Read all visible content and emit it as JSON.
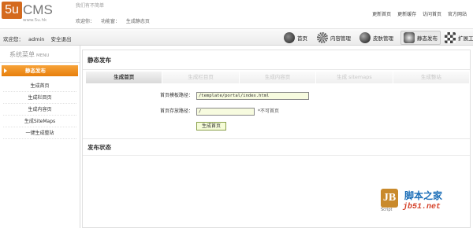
{
  "header": {
    "logo_mark": "5u",
    "logo_text": "CMS",
    "logo_sub": "www.5u.hk",
    "slogan": "我们有不简单",
    "crumbs": [
      "欢迎你：",
      "功能窗：",
      "生成静态页"
    ],
    "top_links": [
      "更新首页",
      "更新缓存",
      "访问首页",
      "官方网站"
    ]
  },
  "userbar": {
    "welcome_label": "欢迎您：",
    "username": "admin",
    "logout": "安全退出",
    "nav": [
      {
        "label": "首页",
        "icon": "home-icon",
        "color": "#3a3a3a"
      },
      {
        "label": "内容管理",
        "icon": "content-icon",
        "color": "#5a5a5a"
      },
      {
        "label": "皮肤管理",
        "icon": "skin-icon",
        "color": "#444444"
      },
      {
        "label": "静态发布",
        "icon": "publish-icon",
        "color": "#333333",
        "active": true
      },
      {
        "label": "扩展工",
        "icon": "extend-icon",
        "color": "#666666"
      }
    ]
  },
  "sidebar": {
    "title": "系统菜单",
    "title_en": "MENU",
    "active": "静态发布",
    "items": [
      "生成首页",
      "生成栏目页",
      "生成内容页",
      "生成SiteMaps",
      "一键生成整站"
    ]
  },
  "main": {
    "title": "静态发布",
    "tabs": [
      "生成首页",
      "生成栏目页",
      "生成内容页",
      "生成 sitemaps",
      "生成整站"
    ],
    "template_label": "首页模板路径：",
    "template_value": "/template/portal/index.html",
    "save_label": "首页存放路径：",
    "save_value": "/",
    "save_hint": "*不可首页",
    "generate_button": "生成首页",
    "status_title": "发布状态"
  },
  "watermark": {
    "icon_text": "JB",
    "script_text": "Script",
    "cn_text": "脚本之家",
    "url_text": "jb51.net"
  }
}
